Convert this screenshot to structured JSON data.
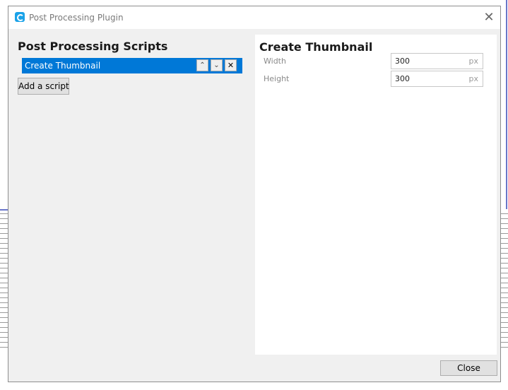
{
  "window": {
    "title": "Post Processing Plugin",
    "close_glyph": "✕"
  },
  "scripts_panel": {
    "heading": "Post Processing Scripts",
    "scripts": [
      {
        "label": "Create Thumbnail",
        "selected": true,
        "move_up_glyph": "⌃",
        "move_down_glyph": "⌄",
        "remove_glyph": "✕"
      }
    ],
    "add_button_label": "Add a script"
  },
  "settings_panel": {
    "heading": "Create Thumbnail",
    "fields": [
      {
        "label": "Width",
        "value": "300",
        "unit": "px"
      },
      {
        "label": "Height",
        "value": "300",
        "unit": "px"
      }
    ]
  },
  "footer": {
    "close_button_label": "Close"
  },
  "colors": {
    "accent": "#0078d7",
    "app_icon": "#1aa2e8",
    "dialog_bg": "#f0f0f0",
    "panel_bg": "#ffffff"
  },
  "icons": {
    "app": "cura-logo-icon",
    "close": "close-icon",
    "up": "chevron-up-icon",
    "down": "chevron-down-icon",
    "remove": "remove-icon"
  }
}
